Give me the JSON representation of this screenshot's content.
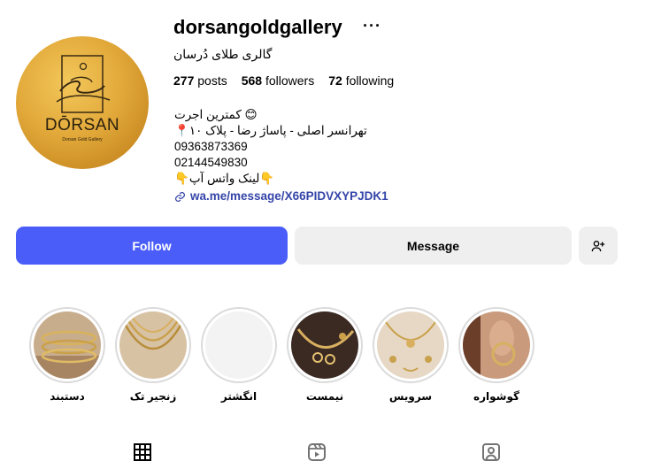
{
  "profile": {
    "username": "dorsangoldgallery",
    "full_name": "گالری طلای دُرسان",
    "more_label": "···",
    "avatar": {
      "brand": "DŌRSAN",
      "sub": "Dorsan Gold Gallery"
    }
  },
  "stats": {
    "posts_count": "277",
    "posts_label": "posts",
    "followers_count": "568",
    "followers_label": "followers",
    "following_count": "72",
    "following_label": "following"
  },
  "bio": {
    "line1": "کمترین اجرت 😊",
    "line2": "📍تهرانسر اصلی - پاساژ رضا - پلاک ۱۰",
    "phone1": "09363873369",
    "phone2": "02144549830",
    "line5": "👇لینک واتس آپ👇",
    "link": "wa.me/message/X66PIDVXYPJDK1"
  },
  "actions": {
    "follow": "Follow",
    "message": "Message",
    "add_user_icon": "person-plus-icon"
  },
  "highlights": [
    {
      "label": "دستبند"
    },
    {
      "label": "زنجیر تک"
    },
    {
      "label": "انگشتر"
    },
    {
      "label": "نیمست"
    },
    {
      "label": "سرویس"
    },
    {
      "label": "گوشواره"
    }
  ],
  "tabs": [
    {
      "icon": "grid-icon",
      "active": true
    },
    {
      "icon": "reels-icon",
      "active": false
    },
    {
      "icon": "tagged-icon",
      "active": false
    }
  ],
  "colors": {
    "accent": "#4a5df9",
    "secondary_button": "#efefef",
    "link": "#3545a8",
    "gold": "#e2a93a"
  }
}
